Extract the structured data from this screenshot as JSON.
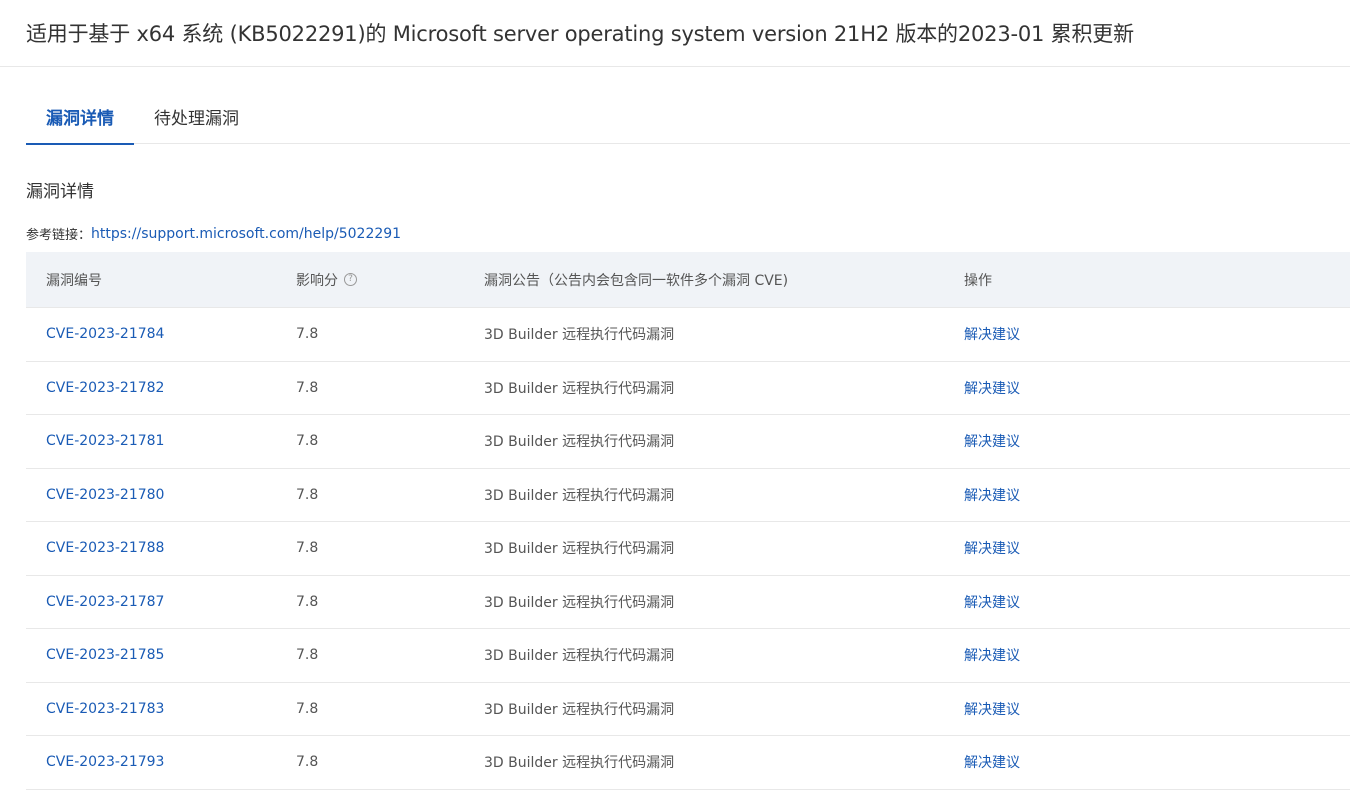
{
  "page": {
    "title": "适用于基于 x64 系统 (KB5022291)的 Microsoft server operating system version 21H2 版本的2023-01 累积更新"
  },
  "tabs": [
    {
      "label": "漏洞详情",
      "active": true
    },
    {
      "label": "待处理漏洞",
      "active": false
    }
  ],
  "section": {
    "title": "漏洞详情",
    "ref_label": "参考链接：",
    "ref_url": "https://support.microsoft.com/help/5022291"
  },
  "table": {
    "headers": {
      "id": "漏洞编号",
      "score": "影响分",
      "bulletin": "漏洞公告（公告内会包含同一软件多个漏洞 CVE)",
      "action": "操作"
    },
    "help_icon": "question-circle-icon",
    "rows": [
      {
        "id": "CVE-2023-21784",
        "score": "7.8",
        "bulletin": "3D Builder 远程执行代码漏洞",
        "action": "解决建议"
      },
      {
        "id": "CVE-2023-21782",
        "score": "7.8",
        "bulletin": "3D Builder 远程执行代码漏洞",
        "action": "解决建议"
      },
      {
        "id": "CVE-2023-21781",
        "score": "7.8",
        "bulletin": "3D Builder 远程执行代码漏洞",
        "action": "解决建议"
      },
      {
        "id": "CVE-2023-21780",
        "score": "7.8",
        "bulletin": "3D Builder 远程执行代码漏洞",
        "action": "解决建议"
      },
      {
        "id": "CVE-2023-21788",
        "score": "7.8",
        "bulletin": "3D Builder 远程执行代码漏洞",
        "action": "解决建议"
      },
      {
        "id": "CVE-2023-21787",
        "score": "7.8",
        "bulletin": "3D Builder 远程执行代码漏洞",
        "action": "解决建议"
      },
      {
        "id": "CVE-2023-21785",
        "score": "7.8",
        "bulletin": "3D Builder 远程执行代码漏洞",
        "action": "解决建议"
      },
      {
        "id": "CVE-2023-21783",
        "score": "7.8",
        "bulletin": "3D Builder 远程执行代码漏洞",
        "action": "解决建议"
      },
      {
        "id": "CVE-2023-21793",
        "score": "7.8",
        "bulletin": "3D Builder 远程执行代码漏洞",
        "action": "解决建议"
      }
    ]
  },
  "colors": {
    "accent": "#1a5bb5",
    "header_bg": "#f0f3f7",
    "border": "#e8e8e8"
  }
}
